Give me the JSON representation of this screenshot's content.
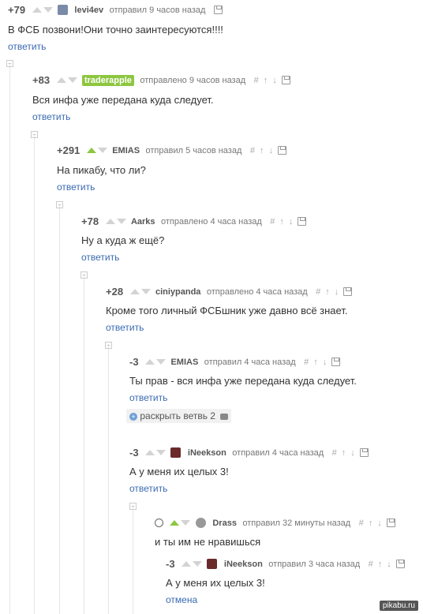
{
  "comments": [
    {
      "rating": "+79",
      "user": "levi4ev",
      "time": "отправил 9 часов назад",
      "text": "В ФСБ позвони!Они точно заинтересуются!!!!",
      "reply": "ответить"
    },
    {
      "rating": "+83",
      "user": "traderapple",
      "time": "отправлено 9 часов назад",
      "text": "Вся инфа уже передана куда следует.",
      "reply": "ответить"
    },
    {
      "rating": "+291",
      "user": "EMIAS",
      "time": "отправил 5 часов назад",
      "text": "На пикабу, что ли?",
      "reply": "ответить"
    },
    {
      "rating": "+78",
      "user": "Aarks",
      "time": "отправлено 4 часа назад",
      "text": "Ну а куда ж ещё?",
      "reply": "ответить"
    },
    {
      "rating": "+28",
      "user": "ciniypanda",
      "time": "отправлено 4 часа назад",
      "text": "Кроме того личный ФСБшник уже давно всё знает.",
      "reply": "ответить"
    },
    {
      "rating": "-3",
      "user": "EMIAS",
      "time": "отправил 4 часа назад",
      "text": "Ты прав - вся инфа уже передана куда следует.",
      "reply": "ответить",
      "expand": "раскрыть ветвь 2"
    },
    {
      "rating": "-3",
      "user": "iNeekson",
      "time": "отправил 4 часа назад",
      "text": "А у меня их целых 3!",
      "reply": "ответить"
    },
    {
      "rating": "",
      "user": "Drass",
      "time": "отправил 32 минуты назад",
      "text": "и ты им не нравишься",
      "reply": ""
    },
    {
      "rating": "-3",
      "user": "iNeekson",
      "time": "отправил 3 часа назад",
      "text": "А у меня их целых 3!",
      "reply": "отмена"
    }
  ],
  "tools": {
    "hash": "#",
    "up": "↑",
    "down": "↓"
  },
  "colors": {
    "link": "#3a6ab1",
    "upvote": "#8dc63f",
    "highlight": "#8dc63f"
  },
  "watermark": "pikabu.ru"
}
